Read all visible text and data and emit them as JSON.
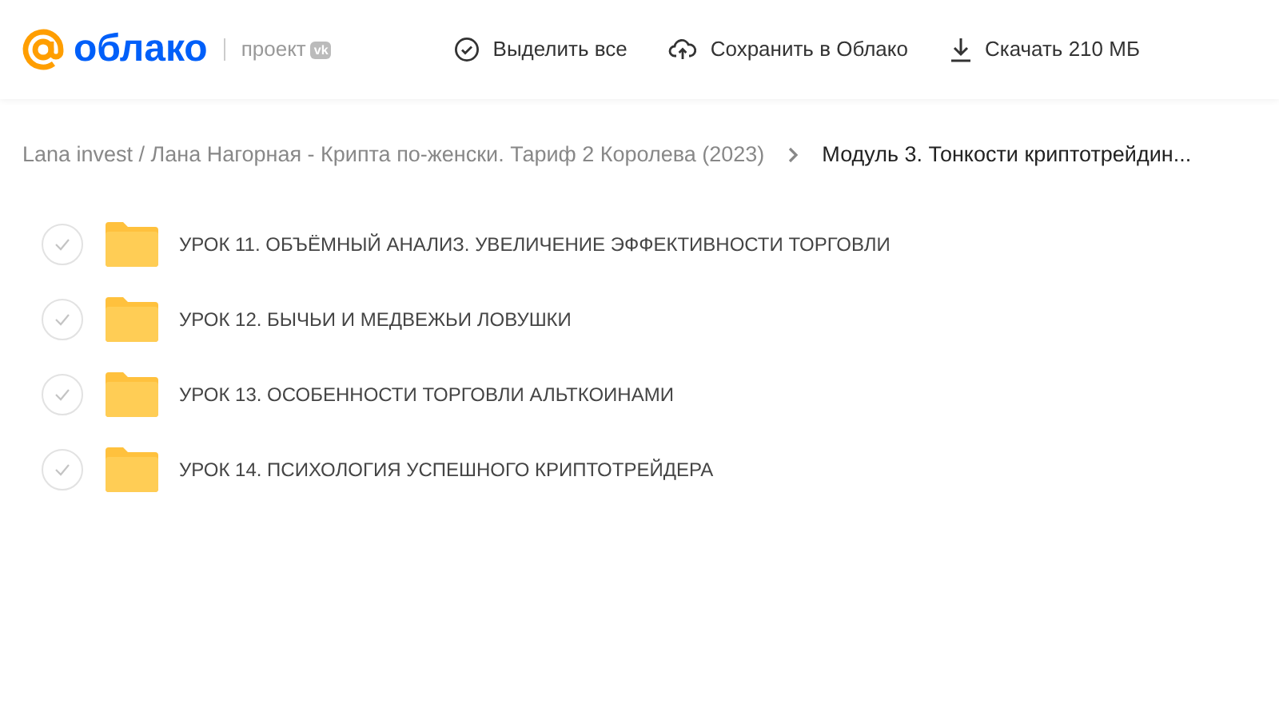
{
  "header": {
    "logo_text": "облако",
    "project_label": "проект",
    "project_badge": "vk",
    "actions": [
      {
        "kind": "select",
        "label": "Выделить все"
      },
      {
        "kind": "save",
        "label": "Сохранить в Облако"
      },
      {
        "kind": "download",
        "label": "Скачать 210 МБ"
      }
    ]
  },
  "breadcrumb": {
    "parent": "Lana invest / Лана Нагорная - Крипта по-женски. Тариф 2 Королева (2023)",
    "current": "Модуль 3. Тонкости криптотрейдин..."
  },
  "folders": [
    {
      "name": "УРОК 11. ОБЪЁМНЫЙ АНАЛИЗ. УВЕЛИЧЕНИЕ ЭФФЕКТИВНОСТИ ТОРГОВЛИ",
      "selected": false
    },
    {
      "name": "УРОК 12. БЫЧЬИ И МЕДВЕЖЬИ ЛОВУШКИ",
      "selected": false
    },
    {
      "name": "УРОК 13. ОСОБЕННОСТИ ТОРГОВЛИ АЛЬТКОИНАМИ",
      "selected": false
    },
    {
      "name": "УРОК 14. ПСИХОЛОГИЯ УСПЕШНОГО КРИПТОТРЕЙДЕРА",
      "selected": false
    }
  ]
}
